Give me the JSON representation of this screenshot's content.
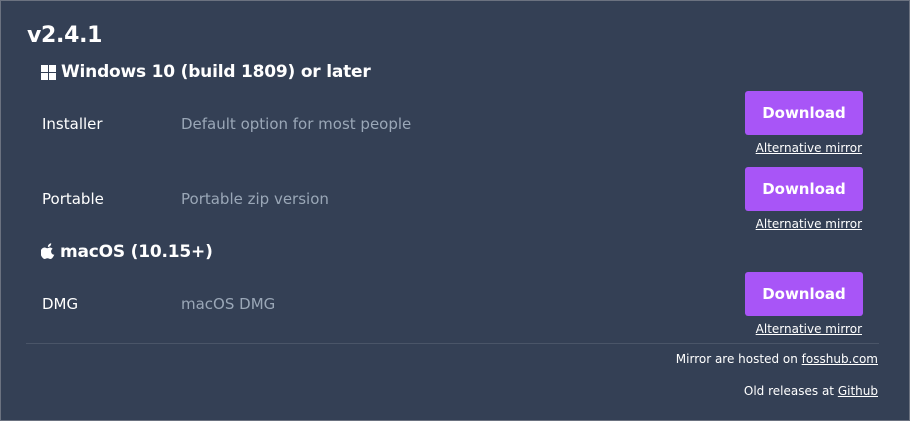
{
  "version": "v2.4.1",
  "windows": {
    "heading": "Windows 10 (build 1809) or later",
    "icon": "windows-icon",
    "rows": [
      {
        "name": "Installer",
        "description": "Default option for most people",
        "button": "Download",
        "mirror": "Alternative mirror"
      },
      {
        "name": "Portable",
        "description": "Portable zip version",
        "button": "Download",
        "mirror": "Alternative mirror"
      }
    ]
  },
  "macos": {
    "heading": "macOS (10.15+)",
    "icon": "apple-icon",
    "rows": [
      {
        "name": "DMG",
        "description": "macOS DMG",
        "button": "Download",
        "mirror": "Alternative mirror"
      }
    ]
  },
  "footer": {
    "mirrors_prefix": "Mirror are hosted on ",
    "mirrors_link": "fosshub.com",
    "releases_prefix": "Old releases at ",
    "releases_link": "Github"
  },
  "colors": {
    "background": "#344055",
    "button": "#a855f7",
    "description": "#9aa7b7"
  }
}
